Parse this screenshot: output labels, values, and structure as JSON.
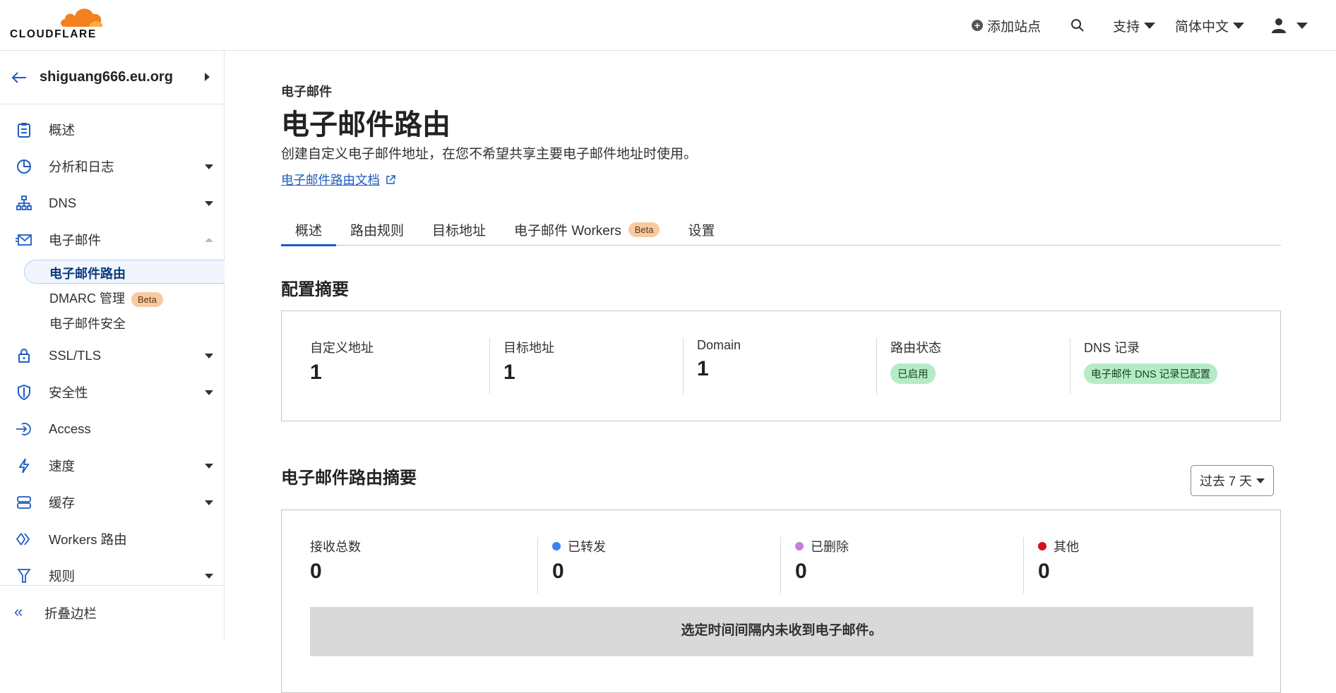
{
  "brand": {
    "logo_text": "CLOUDFLARE",
    "accent": "#f48120",
    "link_color": "#1f5cbf"
  },
  "topbar": {
    "add_site": "添加站点",
    "support": "支持",
    "language": "简体中文"
  },
  "sidebar": {
    "site_name": "shiguang666.eu.org",
    "items": [
      {
        "label": "概述",
        "icon": "clipboard-icon"
      },
      {
        "label": "分析和日志",
        "icon": "pie-chart-icon"
      },
      {
        "label": "DNS",
        "icon": "network-icon"
      },
      {
        "label": "电子邮件",
        "icon": "mail-icon"
      },
      {
        "label": "SSL/TLS",
        "icon": "lock-icon"
      },
      {
        "label": "安全性",
        "icon": "shield-icon"
      },
      {
        "label": "Access",
        "icon": "access-icon"
      },
      {
        "label": "速度",
        "icon": "lightning-icon"
      },
      {
        "label": "缓存",
        "icon": "stack-icon"
      },
      {
        "label": "Workers 路由",
        "icon": "workers-icon"
      },
      {
        "label": "规则",
        "icon": "rules-icon"
      }
    ],
    "email_sub": [
      {
        "label": "电子邮件路由"
      },
      {
        "label": "DMARC 管理",
        "badge": "Beta"
      },
      {
        "label": "电子邮件安全"
      }
    ],
    "collapse": "折叠边栏"
  },
  "page": {
    "breadcrumb": "电子邮件",
    "title": "电子邮件路由",
    "description": "创建自定义电子邮件地址，在您不希望共享主要电子邮件地址时使用。",
    "doc_link": "电子邮件路由文档",
    "tabs": [
      {
        "label": "概述"
      },
      {
        "label": "路由规则"
      },
      {
        "label": "目标地址"
      },
      {
        "label": "电子邮件 Workers",
        "badge": "Beta"
      },
      {
        "label": "设置"
      }
    ]
  },
  "config_summary": {
    "heading": "配置摘要",
    "custom_address": {
      "label": "自定义地址",
      "value": "1"
    },
    "target_address": {
      "label": "目标地址",
      "value": "1"
    },
    "domain": {
      "label": "Domain",
      "value": "1"
    },
    "routing_status": {
      "label": "路由状态",
      "value": "已启用"
    },
    "dns_records": {
      "label": "DNS 记录",
      "value": "电子邮件 DNS 记录已配置"
    }
  },
  "routing_summary": {
    "heading": "电子邮件路由摘要",
    "range": "过去 7 天",
    "total": {
      "label": "接收总数",
      "value": "0"
    },
    "forwarded": {
      "label": "已转发",
      "value": "0",
      "color": "#3b82f6"
    },
    "dropped": {
      "label": "已删除",
      "value": "0",
      "color": "#c77dde"
    },
    "other": {
      "label": "其他",
      "value": "0",
      "color": "#d0121b"
    },
    "empty_message": "选定时间间隔内未收到电子邮件。"
  }
}
